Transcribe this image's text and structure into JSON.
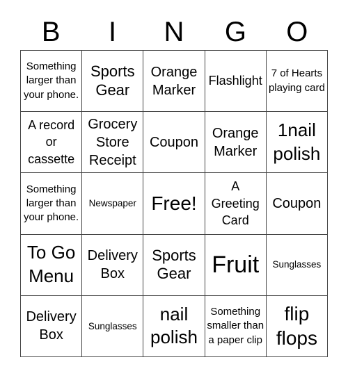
{
  "header": {
    "letters": [
      "B",
      "I",
      "N",
      "G",
      "O"
    ]
  },
  "card": {
    "cells": [
      "Something larger than your phone.",
      "Sports Gear",
      "Orange Marker",
      "Flashlight",
      "7 of Hearts playing card",
      "A record or cassette",
      "Grocery Store Receipt",
      "Coupon",
      "Orange Marker",
      "1nail polish",
      "Something larger than your phone.",
      "Newspaper",
      "Free!",
      "A Greeting Card",
      "Coupon",
      "To Go Menu",
      "Delivery Box",
      "Sports Gear",
      "Fruit",
      "Sunglasses",
      "Delivery Box",
      "Sunglasses",
      "nail polish",
      "Something smaller than a paper clip",
      "flip flops"
    ],
    "free_space_index": 12
  }
}
